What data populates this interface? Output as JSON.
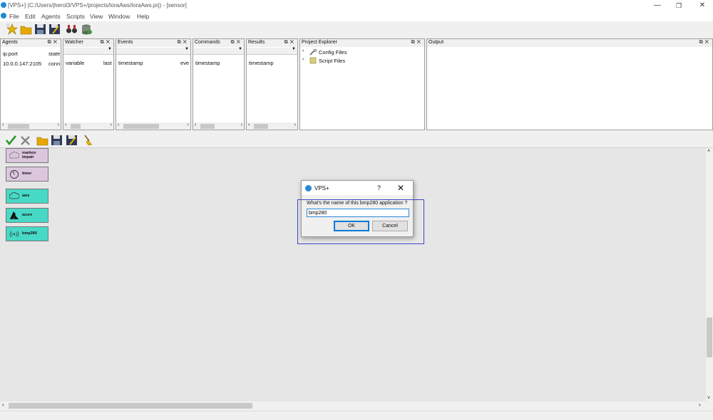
{
  "window": {
    "title": "[VPS+] (C:/Users/jherol3/VPS+/projects/loraAws/loraAws.prj) - [sensor]"
  },
  "menu": [
    "File",
    "Edit",
    "Agents",
    "Scripts",
    "View",
    "Window",
    "Help"
  ],
  "panels": {
    "agents": {
      "title": "Agents",
      "col1": "ip:port",
      "col2": "state",
      "row_ip": "10.0.0.147:2105",
      "row_state": "conn"
    },
    "watcher": {
      "title": "Watcher",
      "col1": "variable",
      "col2": "last"
    },
    "events": {
      "title": "Events",
      "col1": "timestamp",
      "col2": "eve"
    },
    "commands": {
      "title": "Commands",
      "col1": "timestamp"
    },
    "results": {
      "title": "Results",
      "col1": "timestamp"
    },
    "project_explorer": {
      "title": "Project Explorer",
      "items": [
        "Config Files",
        "Script Files"
      ]
    },
    "output": {
      "title": "Output"
    }
  },
  "blocks": [
    {
      "label_line1": "markov",
      "label_line2": "impair",
      "icon": "cloud-outline-icon",
      "color": "#dcc6de"
    },
    {
      "label_line1": "timer",
      "label_line2": "",
      "icon": "clock-icon",
      "color": "#dcc6de"
    },
    {
      "label_line1": "aws",
      "label_line2": "",
      "icon": "cloud-icon",
      "color": "#47d9c6"
    },
    {
      "label_line1": "azure",
      "label_line2": "",
      "icon": "azure-icon",
      "color": "#47d9c6"
    },
    {
      "label_line1": "bmp280",
      "label_line2": "",
      "icon": "sensor-wave-icon",
      "color": "#47d9c6"
    }
  ],
  "dialog": {
    "title": "VPS+",
    "help": "?",
    "close": "✕",
    "prompt": "What's the name of this bmp280 application ?",
    "input_value": "bmp280",
    "ok": "OK",
    "cancel": "Cancel"
  },
  "window_controls": {
    "minimize": "—",
    "maximize": "❐",
    "close": "✕"
  },
  "colors": {
    "accent": "#2b88d8",
    "highlight_box": "#3b47c8"
  }
}
